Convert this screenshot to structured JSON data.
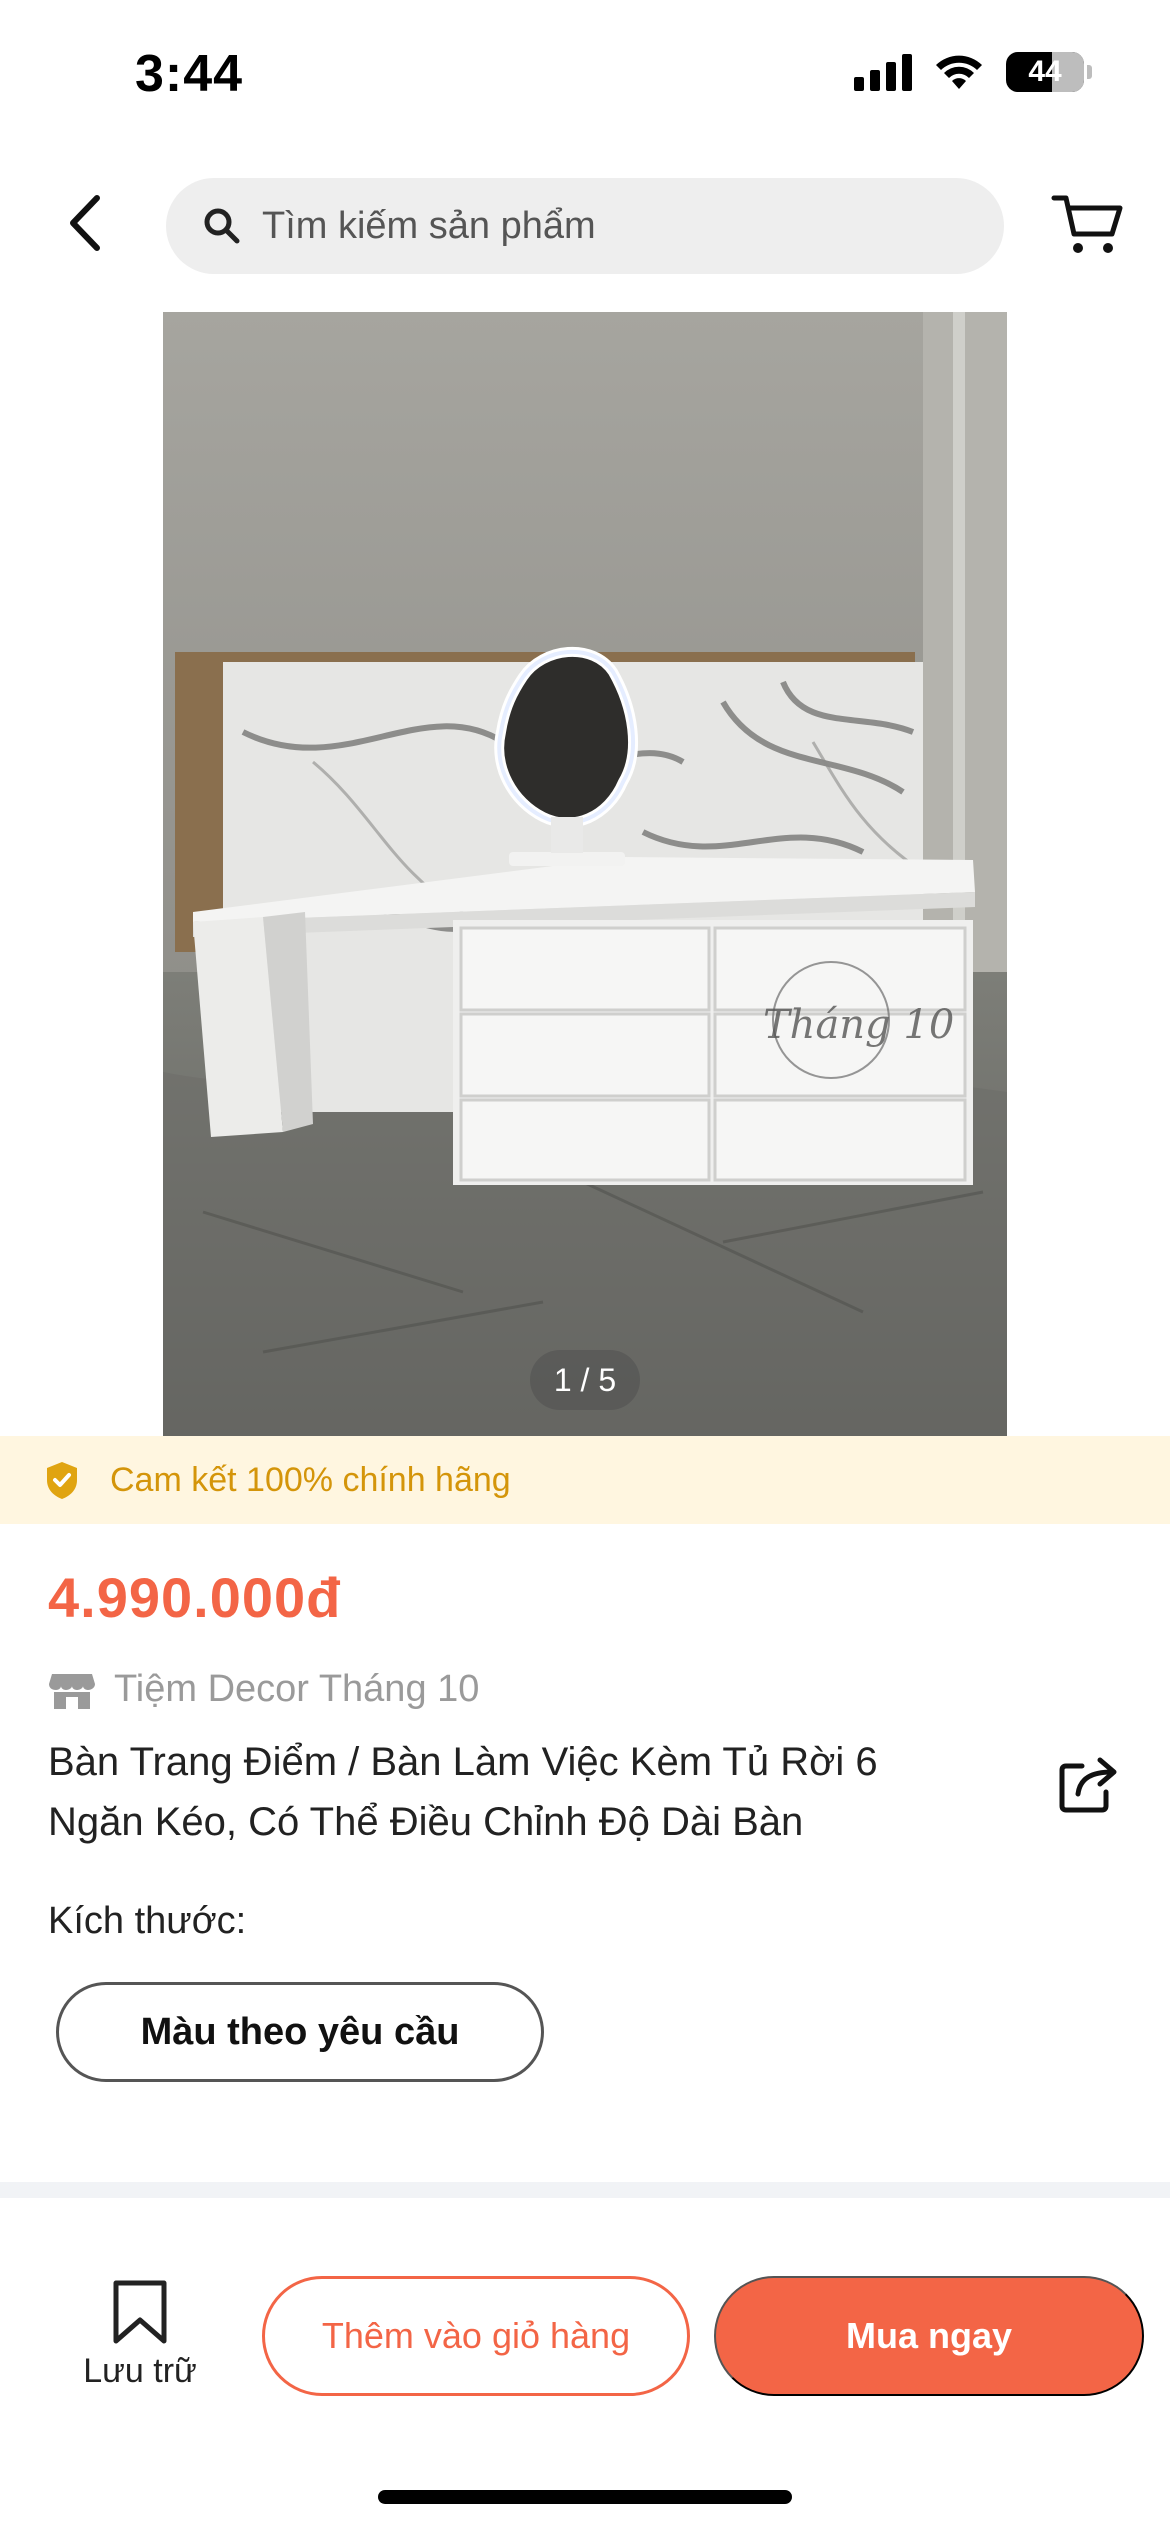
{
  "status_bar": {
    "time": "3:44",
    "battery": "44"
  },
  "header": {
    "search_placeholder": "Tìm kiếm sản phẩm"
  },
  "gallery": {
    "pager": "1 / 5",
    "watermark": "Tháng 10",
    "image_alt": "Product photo: white vanity desk with drawers and LED mirror"
  },
  "guarantee": {
    "label": "Cam kết 100% chính hãng"
  },
  "product": {
    "price": "4.990.000đ",
    "shop_name": "Tiệm Decor Tháng 10",
    "title": "Bàn Trang Điểm / Bàn Làm Việc Kèm Tủ Rời 6 Ngăn Kéo, Có Thể Điều Chỉnh Độ Dài Bàn",
    "size_label": "Kích thước:",
    "variant": "Màu theo yêu cầu"
  },
  "bottom_bar": {
    "save_label": "Lưu trữ",
    "add_to_cart_label": "Thêm vào giỏ hàng",
    "buy_now_label": "Mua ngay"
  },
  "colors": {
    "accent": "#f36546",
    "guarantee_text": "#d4950a",
    "guarantee_bg": "#fff6e0"
  }
}
